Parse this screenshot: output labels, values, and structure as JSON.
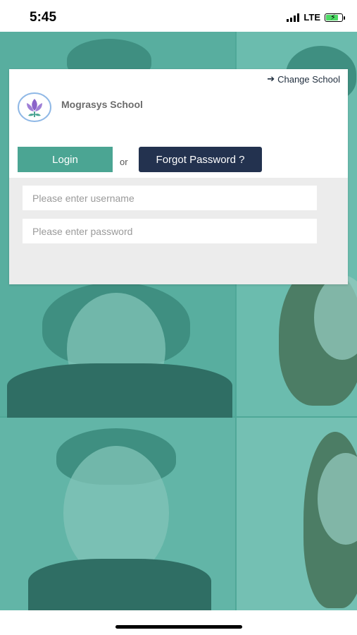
{
  "status_bar": {
    "time": "5:45",
    "network": "LTE"
  },
  "header": {
    "change_school_label": "Change School",
    "school_name": "Mograsys School"
  },
  "actions": {
    "login_label": "Login",
    "or_label": "or",
    "forgot_label": "Forgot Password ?"
  },
  "form": {
    "username_placeholder": "Please enter username",
    "password_placeholder": "Please enter password",
    "username_value": "",
    "password_value": ""
  },
  "colors": {
    "accent": "#4ba593",
    "dark_button": "#23324f",
    "background_tint": "#58ae9f"
  }
}
